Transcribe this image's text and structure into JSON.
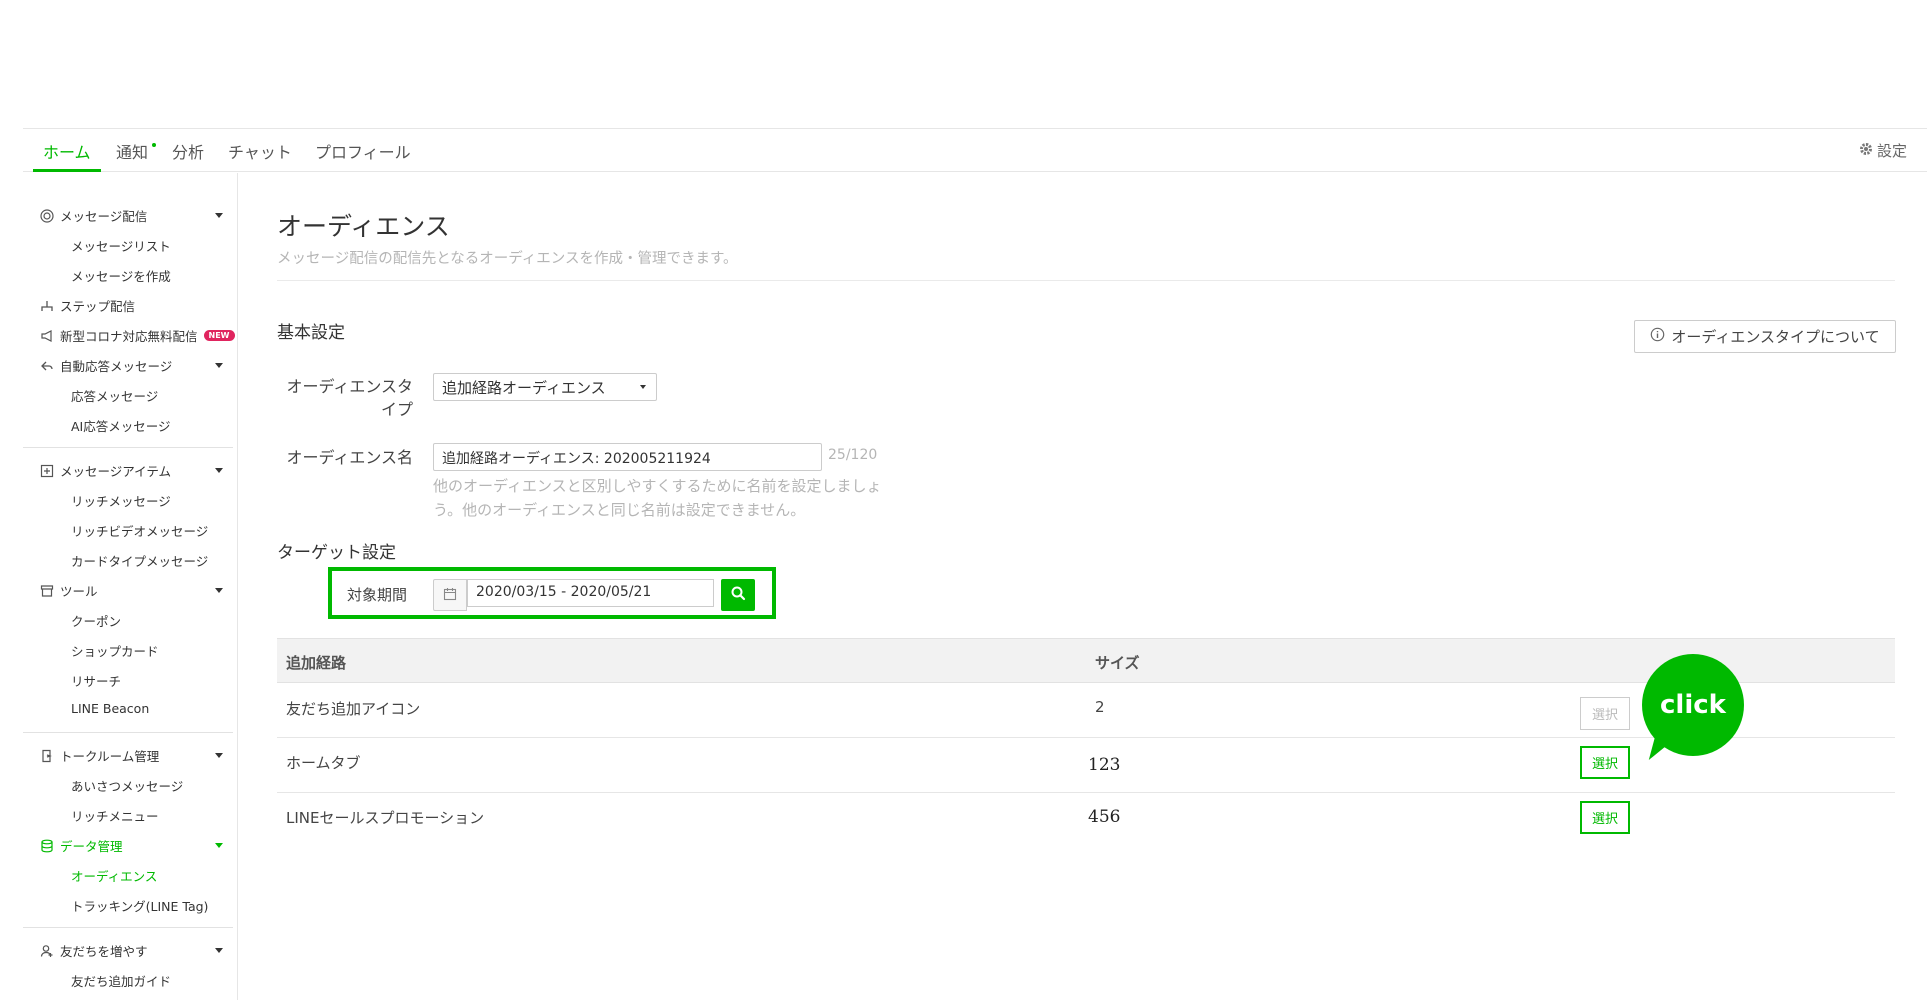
{
  "topnav": {
    "tabs": [
      "ホーム",
      "通知",
      "分析",
      "チャット",
      "プロフィール"
    ],
    "settings_label": "設定"
  },
  "sidebar": {
    "message_delivery": "メッセージ配信",
    "message_list": "メッセージリスト",
    "create_message": "メッセージを作成",
    "step_delivery": "ステップ配信",
    "corona_free": "新型コロナ対応無料配信",
    "new_badge": "NEW",
    "auto_reply": "自動応答メッセージ",
    "reply_message": "応答メッセージ",
    "ai_reply": "AI応答メッセージ",
    "message_items": "メッセージアイテム",
    "rich_message": "リッチメッセージ",
    "rich_video": "リッチビデオメッセージ",
    "card_type": "カードタイプメッセージ",
    "tools": "ツール",
    "coupon": "クーポン",
    "shop_card": "ショップカード",
    "research": "リサーチ",
    "line_beacon": "LINE Beacon",
    "talkroom": "トークルーム管理",
    "greeting": "あいさつメッセージ",
    "rich_menu": "リッチメニュー",
    "data_mgmt": "データ管理",
    "audience": "オーディエンス",
    "tracking": "トラッキング(LINE Tag)",
    "grow_friends": "友だちを増やす",
    "add_friend_guide": "友だち追加ガイド"
  },
  "main": {
    "title": "オーディエンス",
    "description": "メッセージ配信の配信先となるオーディエンスを作成・管理できます。",
    "basic_settings": "基本設定",
    "about_button": "オーディエンスタイプについて",
    "type_label_1": "オーディエンスタ",
    "type_label_2": "イプ",
    "type_value": "追加経路オーディエンス",
    "name_label": "オーディエンス名",
    "name_value": "追加経路オーディエンス: 202005211924",
    "name_counter": "25/120",
    "name_helper": "他のオーディエンスと区別しやすくするために名前を設定しましょう。他のオーディエンスと同じ名前は設定できません。",
    "target_settings": "ターゲット設定",
    "period_label": "対象期間",
    "period_value": "2020/03/15 - 2020/05/21"
  },
  "table": {
    "col_source": "追加経路",
    "col_size": "サイズ",
    "rows": [
      {
        "source": "友だち追加アイコン",
        "size": "2",
        "button": "選択"
      },
      {
        "source": "ホームタブ",
        "size": "123",
        "button": "選択"
      },
      {
        "source": "LINEセールスプロモーション",
        "size": "456",
        "button": "選択"
      }
    ]
  },
  "callout": {
    "text": "click"
  },
  "colors": {
    "accent": "#00b900",
    "badge": "#e0245e"
  }
}
